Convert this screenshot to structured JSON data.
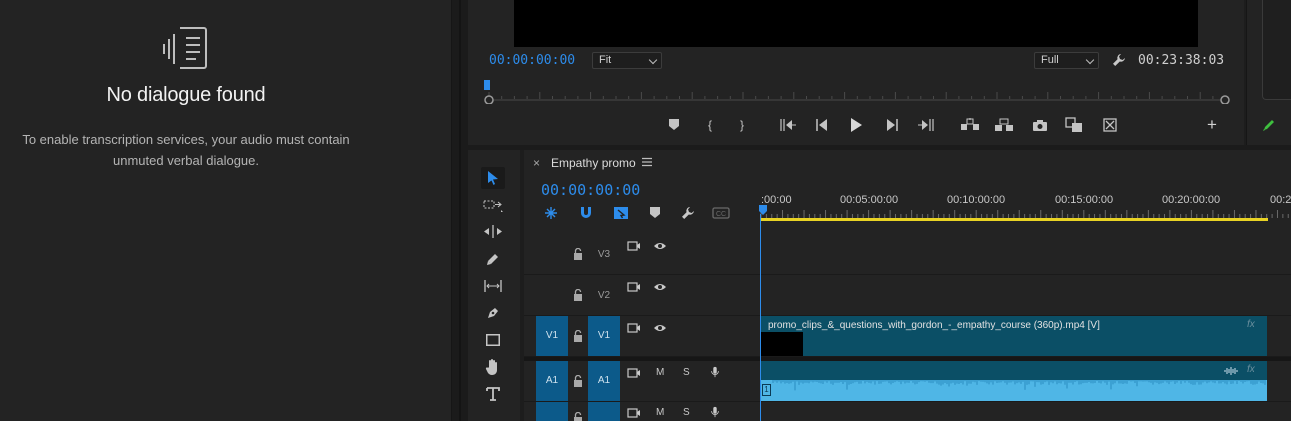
{
  "transcript_panel": {
    "title": "No dialogue found",
    "description": "To enable transcription services, your audio must contain unmuted verbal dialogue.",
    "icon": "transcript-waveform-icon"
  },
  "program_monitor": {
    "playhead_timecode": "00:00:00:00",
    "fit_dropdown": "Fit",
    "resolution_dropdown": "Full",
    "duration_timecode": "00:23:38:03",
    "controls": [
      "add-marker",
      "mark-in",
      "mark-out",
      "go-to-in",
      "step-back",
      "play",
      "step-forward",
      "go-to-out",
      "lift",
      "extract",
      "export-frame",
      "comparison-view",
      "multi-camera",
      "add-button"
    ]
  },
  "timeline": {
    "sequence_name": "Empathy promo",
    "close_label": "×",
    "timecode": "00:00:00:00",
    "ruler_labels": [
      ":00:00",
      "00:05:00:00",
      "00:10:00:00",
      "00:15:00:00",
      "00:20:00:00",
      "00:2"
    ],
    "tracks": {
      "v3": {
        "target": "V3"
      },
      "v2": {
        "target": "V2"
      },
      "v1": {
        "source": "V1",
        "target": "V1"
      },
      "a1": {
        "source": "A1",
        "target": "A1",
        "mute": "M",
        "solo": "S"
      },
      "a2": {
        "mute": "M",
        "solo": "S"
      }
    },
    "video_clip": {
      "name": "promo_clips_&_questions_with_gordon_-_empathy_course (360p).mp4 [V]",
      "fx": "fx"
    },
    "audio_clip": {
      "fx": "fx",
      "channel_badge": "1"
    }
  },
  "colors": {
    "accent_blue": "#2d8ceb",
    "clip_teal": "#0b4f66",
    "waveform": "#4fb6e6",
    "work_area": "#e8d224"
  }
}
